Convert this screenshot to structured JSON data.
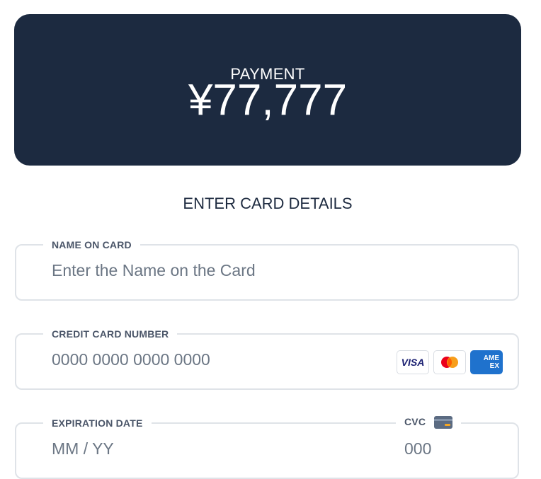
{
  "payment": {
    "label": "PAYMENT",
    "amount": "¥77,777"
  },
  "section_title": "ENTER CARD DETAILS",
  "fields": {
    "name": {
      "label": "NAME ON CARD",
      "placeholder": "Enter the Name on the Card"
    },
    "card_number": {
      "label": "CREDIT CARD NUMBER",
      "placeholder": "0000 0000 0000 0000",
      "card_brands": {
        "visa": "VISA",
        "mastercard": "mastercard-logo",
        "amex_top": "AME",
        "amex_bottom": "EX"
      }
    },
    "expiration": {
      "label": "EXPIRATION DATE",
      "placeholder": "MM / YY"
    },
    "cvc": {
      "label": "CVC",
      "icon": "credit-card-icon",
      "placeholder": "000"
    }
  },
  "colors": {
    "banner_bg": "#1c2a40",
    "field_border": "#dfe3e8",
    "amex_blue": "#1f72cd",
    "mastercard_red": "#eb001b",
    "mastercard_orange": "#f79e1b"
  }
}
